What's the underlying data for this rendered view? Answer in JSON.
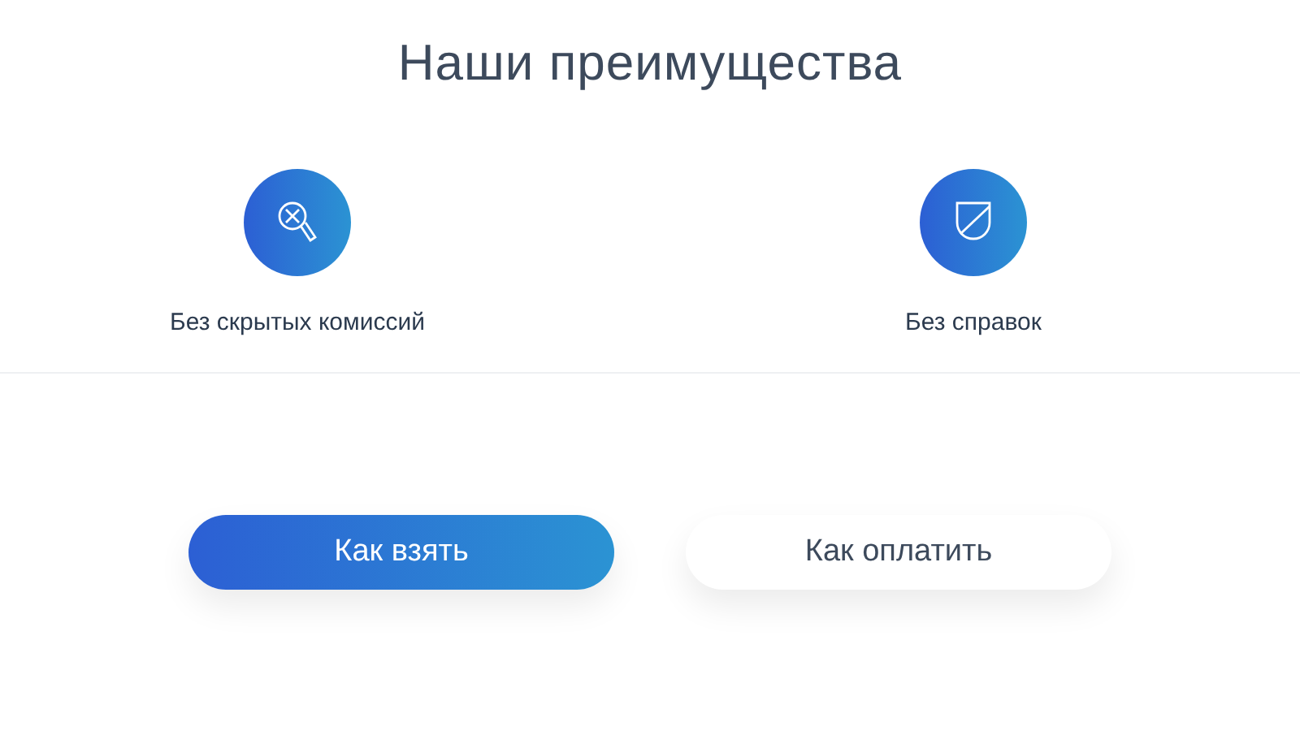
{
  "title": "Наши преимущества",
  "features": [
    {
      "kind": "search",
      "label": "Без скрытых комиссий"
    },
    {
      "kind": "shield",
      "label": "Без справок"
    }
  ],
  "buttons": [
    {
      "label": "Как взять",
      "selected": true
    },
    {
      "label": "Как оплатить",
      "selected": false
    }
  ]
}
